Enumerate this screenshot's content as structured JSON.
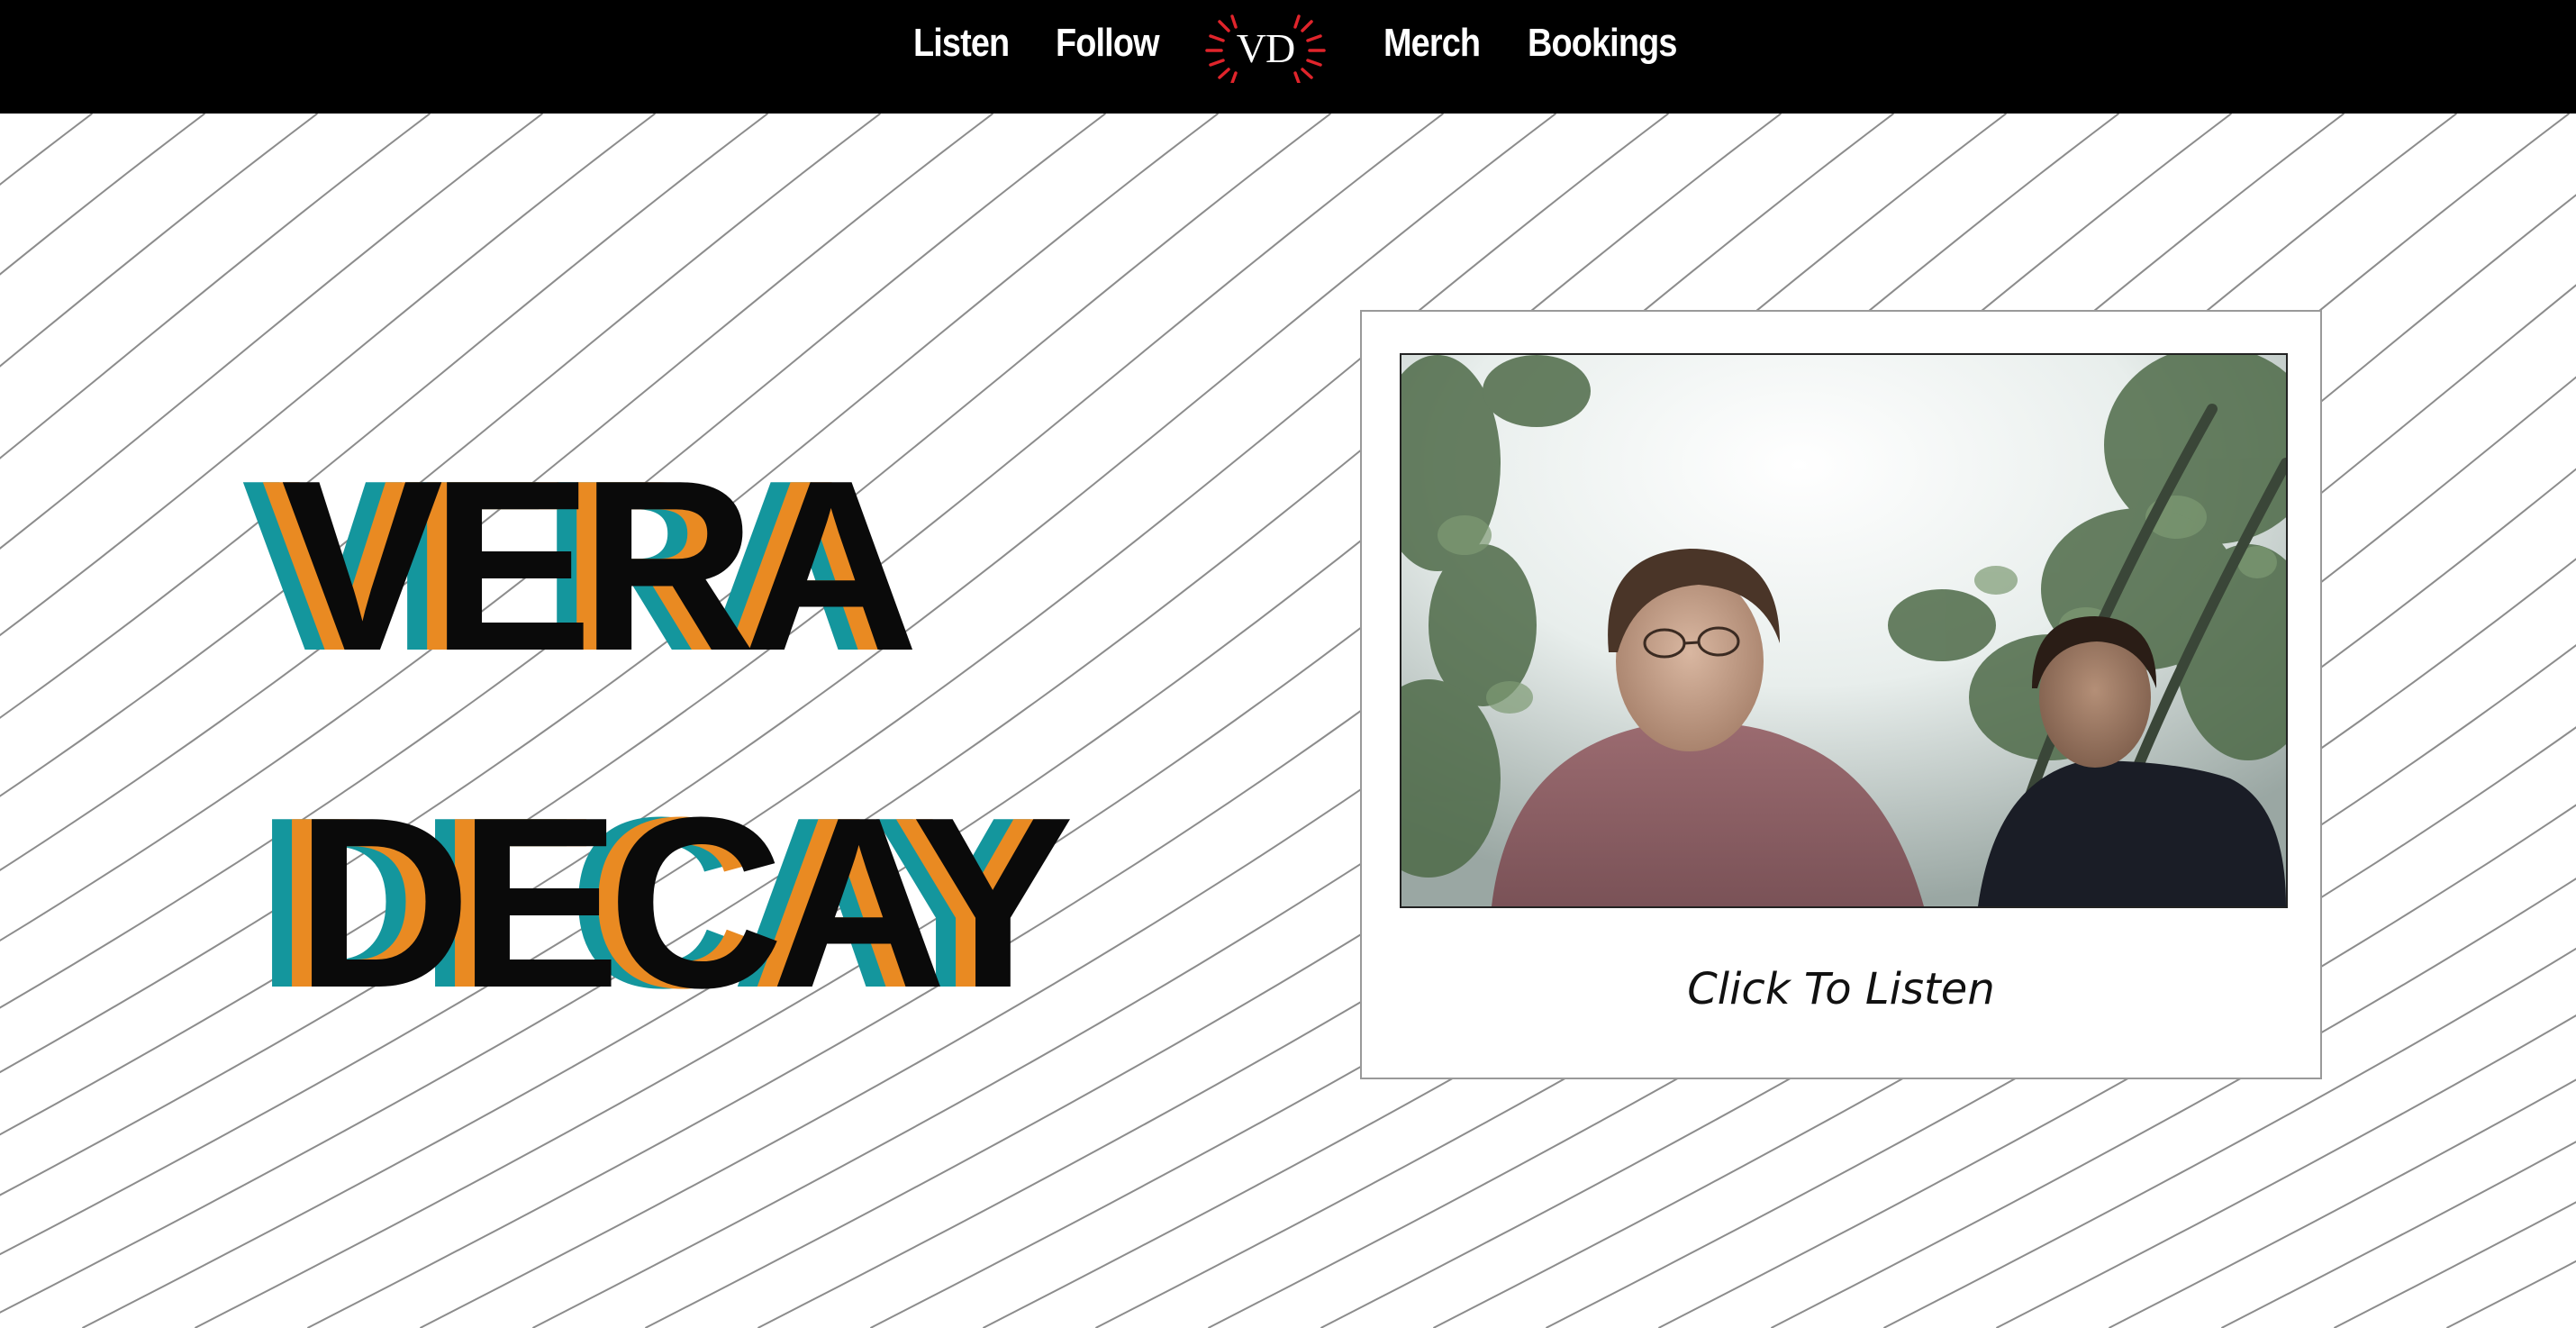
{
  "nav": {
    "links": [
      {
        "label": "Listen"
      },
      {
        "label": "Follow"
      },
      {
        "label": "Merch"
      },
      {
        "label": "Bookings"
      }
    ],
    "logo_text": "VD"
  },
  "hero": {
    "line1": "VERA",
    "line2": "DECAY"
  },
  "polaroid": {
    "caption": "Click To Listen"
  },
  "colors": {
    "nav_background": "#000000",
    "nav_text": "#ffffff",
    "logo_rays": "#e0242b",
    "title_black": "#0a0a0a",
    "title_teal": "#14969d",
    "title_orange": "#e98a22",
    "wave_lines": "#8c8c8c",
    "page_background": "#ffffff"
  }
}
